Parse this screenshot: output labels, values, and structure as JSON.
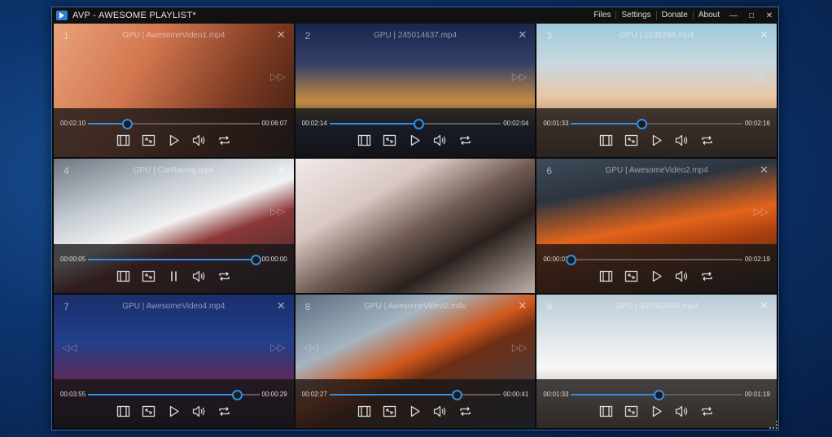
{
  "window": {
    "title": "AVP - AWESOME PLAYLIST*",
    "menu": [
      "Files",
      "Settings",
      "Donate",
      "About"
    ]
  },
  "colors": {
    "accent": "#2f8fe6",
    "titlebar": "#111111",
    "window_border": "#2f6fb8"
  },
  "icons": [
    "playlist-icon",
    "fullscreen-icon",
    "play-icon",
    "pause-icon",
    "volume-icon",
    "repeat-icon",
    "close-icon",
    "skip-forward-icon",
    "skip-back-icon"
  ],
  "cells": [
    {
      "number": "1",
      "title": "GPU | AwesomeVideo1.mp4",
      "current": "00:02:10",
      "total": "00:06:07",
      "progress": 0.23,
      "playing": false,
      "show_controls": true,
      "skip_back": false,
      "bg": "linear-gradient(120deg,#e9a27a 0%,#d2764f 35%,#7d3a22 70%,#3c1d12 100%)"
    },
    {
      "number": "2",
      "title": "GPU | 245014637.mp4",
      "current": "00:02:14",
      "total": "00:02:04",
      "progress": 0.52,
      "playing": false,
      "show_controls": true,
      "skip_back": false,
      "bg": "linear-gradient(180deg,#18264a 0%,#35406a 30%,#c5893f 58%,#27365e 78%,#0c1325 100%)"
    },
    {
      "number": "3",
      "title": "GPU | 1238298.mp4",
      "current": "00:01:33",
      "total": "00:02:16",
      "progress": 0.41,
      "playing": false,
      "show_controls": true,
      "skip_back": false,
      "bg": "linear-gradient(180deg,#9ec8da 0%,#c9d8df 30%,#e7c7a6 55%,#b88561 78%,#7b563d 100%)"
    },
    {
      "number": "4",
      "title": "GPU | CarRacing.mp4",
      "current": "00:00:05",
      "total": "00:00:00",
      "progress": 0.98,
      "playing": true,
      "show_controls": true,
      "skip_back": false,
      "bg": "linear-gradient(160deg,#6f7680 0%,#c7cdd4 30%,#f2f2f2 48%,#8c3737 62%,#2a2b2f 100%)"
    },
    {
      "number": "",
      "title": "",
      "current": "",
      "total": "",
      "progress": 0,
      "playing": false,
      "show_controls": false,
      "skip_back": false,
      "bg": "linear-gradient(150deg,#f1e9ea 0%,#d9c8c3 30%,#6e5a52 52%,#2a201d 70%,#bfb0a8 100%)"
    },
    {
      "number": "6",
      "title": "GPU | AwesomeVideo2.mp4",
      "current": "00:00:01",
      "total": "00:02:19",
      "progress": 0.0,
      "playing": false,
      "show_controls": true,
      "skip_back": false,
      "bg": "linear-gradient(170deg,#3f4b59 0%,#2c3440 25%,#e2641c 50%,#a93f0e 65%,#222 100%)"
    },
    {
      "number": "7",
      "title": "GPU | AwesomeVideo4.mp4",
      "current": "00:03:55",
      "total": "00:00:29",
      "progress": 0.87,
      "playing": false,
      "show_controls": true,
      "skip_back": true,
      "bg": "linear-gradient(180deg,#1b2d6b 0%,#233e8a 35%,#5c2a57 65%,#221424 100%)"
    },
    {
      "number": "8",
      "title": "GPU | AwesomeVideo2.m4v",
      "current": "00:02:27",
      "total": "00:00:41",
      "progress": 0.74,
      "playing": false,
      "show_controls": true,
      "skip_back": true,
      "bg": "linear-gradient(155deg,#5a6d80 0%,#a4b4c0 30%,#d0561b 48%,#6c2e14 58%,#374452 100%)"
    },
    {
      "number": "9",
      "title": "GPU | 301652645.mp4",
      "current": "00:01:33",
      "total": "00:01:19",
      "progress": 0.51,
      "playing": false,
      "show_controls": true,
      "skip_back": false,
      "bg": "linear-gradient(180deg,#b9cbd6 0%,#e4e8ec 35%,#f7f7f8 55%,#c9b19b 80%,#8e7462 100%)"
    }
  ]
}
